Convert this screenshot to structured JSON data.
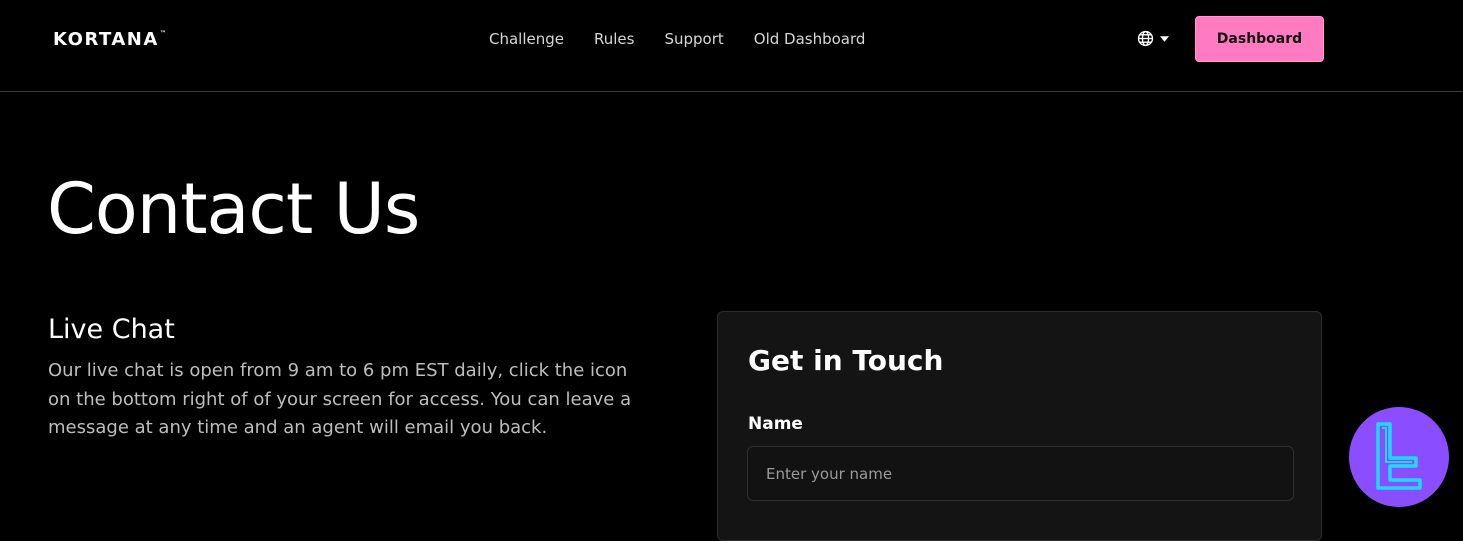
{
  "header": {
    "logo_text": "KORTANA",
    "logo_tm": "™",
    "nav": [
      {
        "label": "Challenge"
      },
      {
        "label": "Rules"
      },
      {
        "label": "Support"
      },
      {
        "label": "Old Dashboard"
      }
    ],
    "language_icon": "globe-icon",
    "dashboard_label": "Dashboard"
  },
  "page": {
    "title": "Contact Us"
  },
  "live_chat": {
    "title": "Live Chat",
    "text": "Our live chat is open from 9 am to 6 pm EST daily, click the icon on the bottom right of of your screen for access. You can leave a message at any time and an agent will email you back."
  },
  "contact_form": {
    "title": "Get in Touch",
    "name_label": "Name",
    "name_placeholder": "Enter your name",
    "name_value": ""
  },
  "colors": {
    "background": "#000000",
    "accent": "#ff7ac0",
    "card": "#141414",
    "badge": "#8a4dff"
  }
}
